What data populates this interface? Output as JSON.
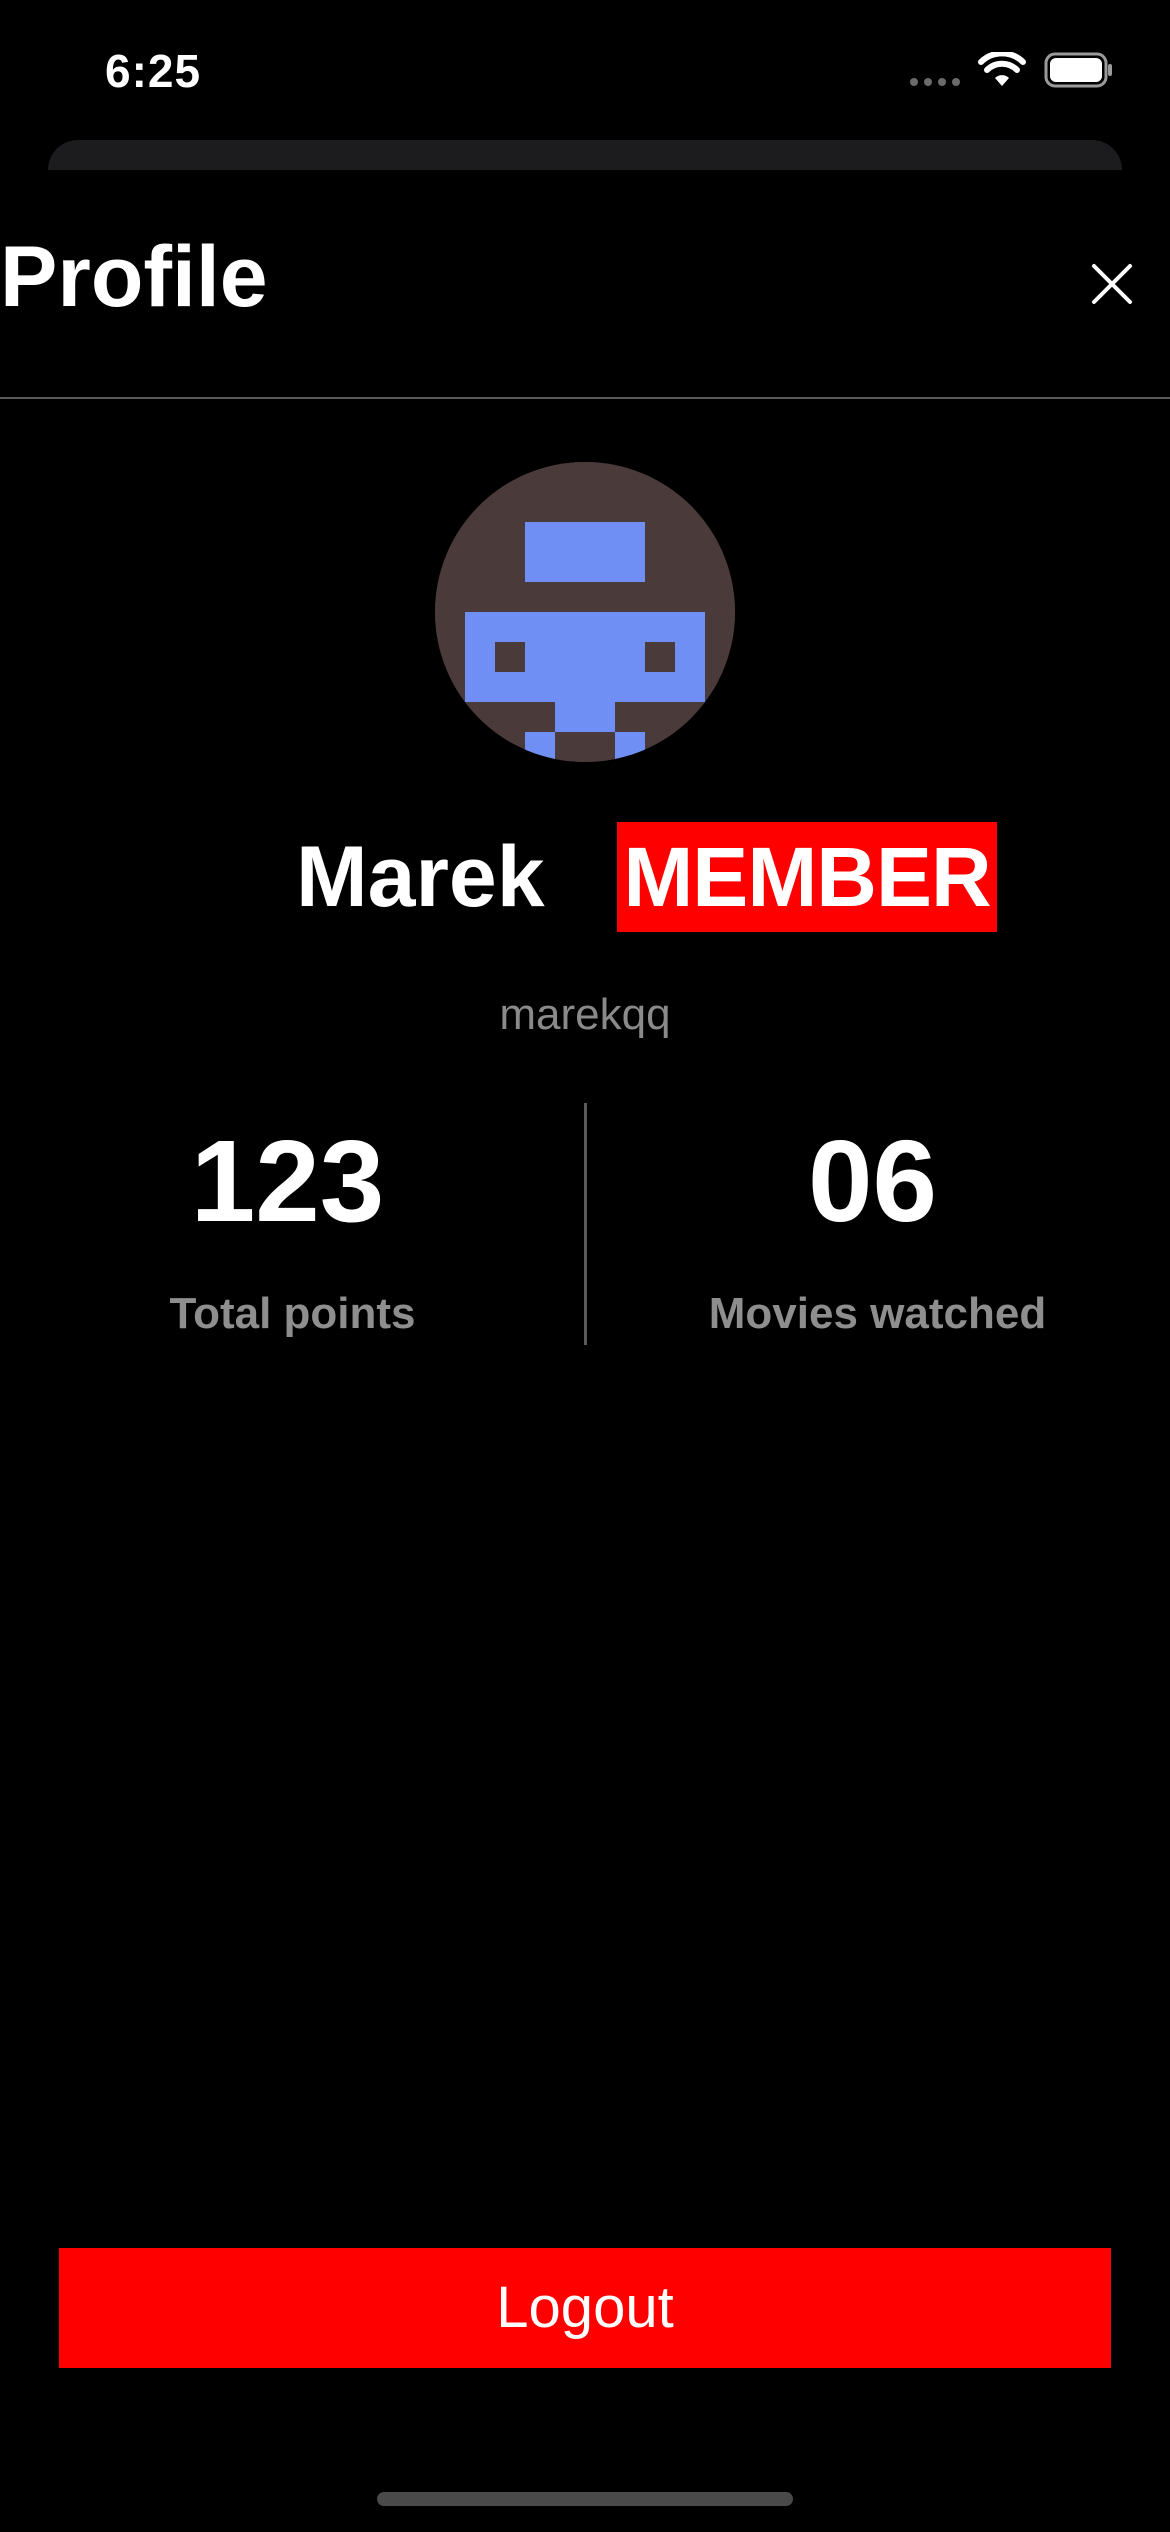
{
  "status_bar": {
    "time": "6:25",
    "icons": [
      "signal-icon",
      "wifi-icon",
      "battery-icon"
    ]
  },
  "header": {
    "title": "Profile",
    "close_icon": "close-icon"
  },
  "profile": {
    "avatar_icon": "pixel-avatar",
    "name": "Marek",
    "badge": "MEMBER",
    "username": "marekqq"
  },
  "stats": [
    {
      "value": "123",
      "label": "Total points"
    },
    {
      "value": "06",
      "label": "Movies watched"
    }
  ],
  "actions": {
    "logout_label": "Logout"
  },
  "colors": {
    "background": "#000000",
    "accent": "#ff0000",
    "muted_text": "#8e8e8e",
    "avatar_bg": "#4a3a3a",
    "avatar_fg": "#6f8ff5"
  }
}
